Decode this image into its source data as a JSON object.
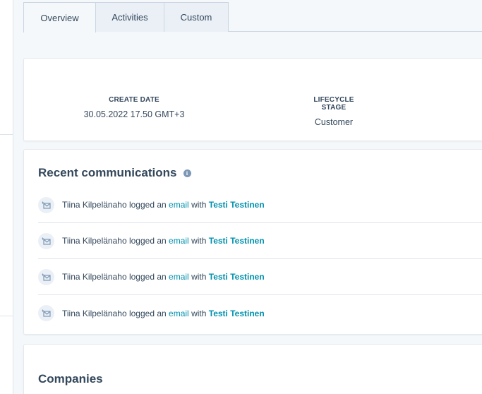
{
  "tabs": [
    {
      "label": "Overview",
      "active": true
    },
    {
      "label": "Activities",
      "active": false
    },
    {
      "label": "Custom",
      "active": false
    }
  ],
  "properties": {
    "create_date": {
      "label": "CREATE DATE",
      "value": "30.05.2022 17.50 GMT+3"
    },
    "lifecycle_stage": {
      "label": "LIFECYCLE STAGE",
      "value": "Customer"
    }
  },
  "recent_communications": {
    "title": "Recent communications",
    "items": [
      {
        "actor": "Tiina Kilpelänaho",
        "verb": "logged an",
        "type": "email",
        "joiner": "with",
        "contact": "Testi Testinen"
      },
      {
        "actor": "Tiina Kilpelänaho",
        "verb": "logged an",
        "type": "email",
        "joiner": "with",
        "contact": "Testi Testinen"
      },
      {
        "actor": "Tiina Kilpelänaho",
        "verb": "logged an",
        "type": "email",
        "joiner": "with",
        "contact": "Testi Testinen"
      },
      {
        "actor": "Tiina Kilpelänaho",
        "verb": "logged an",
        "type": "email",
        "joiner": "with",
        "contact": "Testi Testinen"
      }
    ]
  },
  "companies": {
    "title": "Companies"
  },
  "colors": {
    "link": "#0091ae",
    "text": "#33475b",
    "background": "#f5f8fa",
    "border": "#cbd6e2"
  },
  "icons": {
    "info": "info-icon",
    "email": "email-icon"
  }
}
